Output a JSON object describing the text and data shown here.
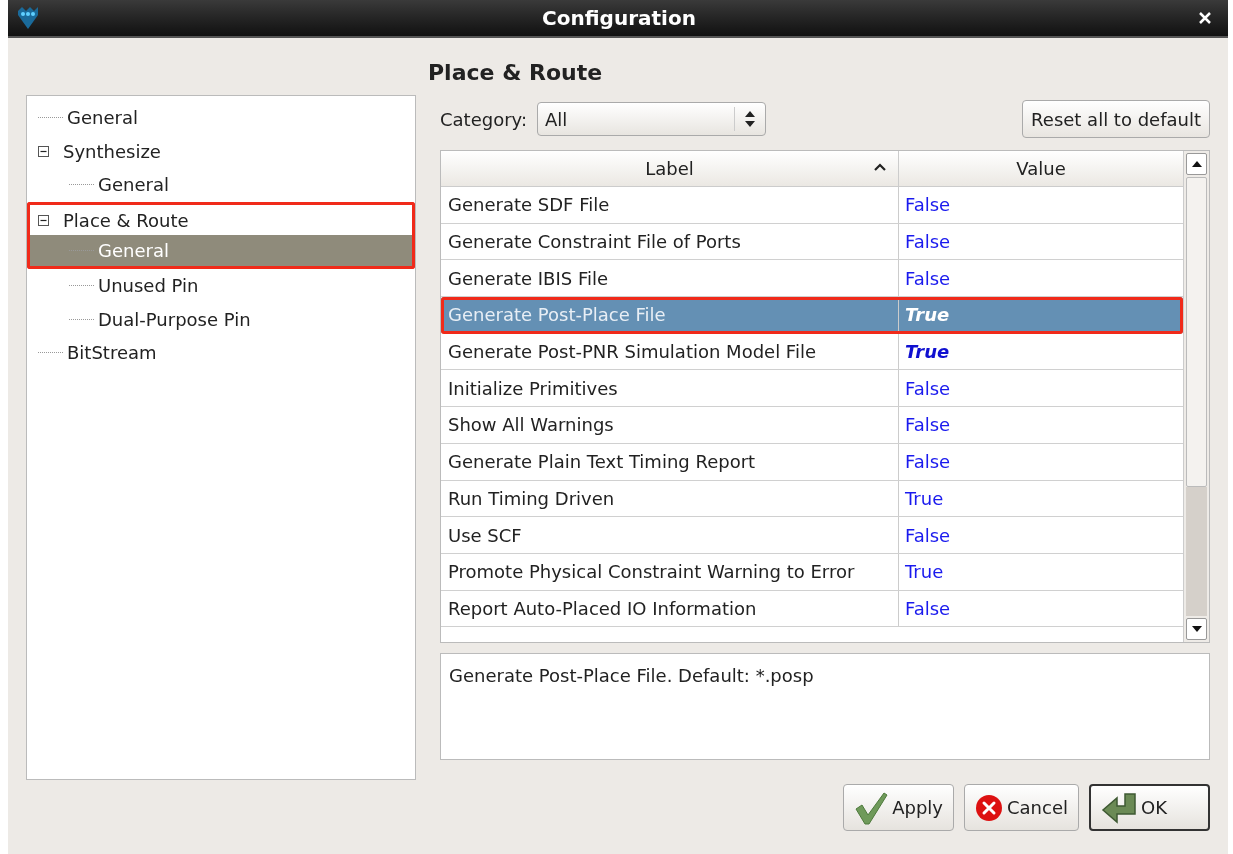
{
  "window": {
    "title": "Configuration"
  },
  "tree": [
    {
      "label": "General",
      "selected": false,
      "highlighted": false
    },
    {
      "label": "Synthesize",
      "selected": false,
      "highlighted": false,
      "expanded": true,
      "children": [
        {
          "label": "General",
          "selected": false,
          "highlighted": false
        }
      ]
    },
    {
      "label": "Place & Route",
      "selected": false,
      "highlighted": true,
      "expanded": true,
      "children": [
        {
          "label": "General",
          "selected": true,
          "highlighted": true
        },
        {
          "label": "Unused Pin",
          "selected": false,
          "highlighted": false
        },
        {
          "label": "Dual-Purpose Pin",
          "selected": false,
          "highlighted": false
        }
      ]
    },
    {
      "label": "BitStream",
      "selected": false,
      "highlighted": false
    }
  ],
  "page_title": "Place & Route",
  "category": {
    "label": "Category:",
    "value": "All"
  },
  "reset_button": "Reset all to default",
  "table": {
    "columns": [
      "Label",
      "Value"
    ],
    "rows": [
      {
        "label": "Generate SDF File",
        "value": "False",
        "selected": false,
        "modified": false,
        "highlighted": false
      },
      {
        "label": "Generate Constraint File of Ports",
        "value": "False",
        "selected": false,
        "modified": false,
        "highlighted": false
      },
      {
        "label": "Generate IBIS File",
        "value": "False",
        "selected": false,
        "modified": false,
        "highlighted": false
      },
      {
        "label": "Generate Post-Place File",
        "value": "True",
        "selected": true,
        "modified": true,
        "highlighted": true
      },
      {
        "label": "Generate Post-PNR Simulation Model File",
        "value": "True",
        "selected": false,
        "modified": true,
        "highlighted": false
      },
      {
        "label": "Initialize Primitives",
        "value": "False",
        "selected": false,
        "modified": false,
        "highlighted": false
      },
      {
        "label": "Show All Warnings",
        "value": "False",
        "selected": false,
        "modified": false,
        "highlighted": false
      },
      {
        "label": "Generate Plain Text Timing Report",
        "value": "False",
        "selected": false,
        "modified": false,
        "highlighted": false
      },
      {
        "label": "Run Timing Driven",
        "value": "True",
        "selected": false,
        "modified": false,
        "highlighted": false
      },
      {
        "label": "Use SCF",
        "value": "False",
        "selected": false,
        "modified": false,
        "highlighted": false
      },
      {
        "label": "Promote Physical Constraint Warning to Error",
        "value": "True",
        "selected": false,
        "modified": false,
        "highlighted": false
      },
      {
        "label": "Report Auto-Placed IO Information",
        "value": "False",
        "selected": false,
        "modified": false,
        "highlighted": false
      }
    ]
  },
  "description": "Generate Post-Place File. Default: *.posp",
  "buttons": [
    {
      "kind": "apply",
      "label": "Apply"
    },
    {
      "kind": "cancel",
      "label": "Cancel"
    },
    {
      "kind": "ok",
      "label": "OK"
    }
  ]
}
